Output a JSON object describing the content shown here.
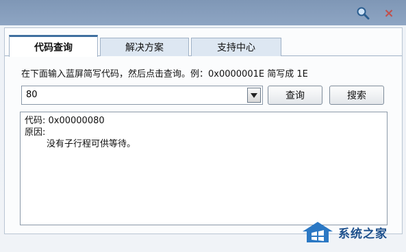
{
  "title_bar": {
    "search_icon": "magnifier-icon",
    "close_icon": "close-x-icon",
    "close_glyph": "×"
  },
  "tabs": [
    {
      "label": "代码查询",
      "active": true
    },
    {
      "label": "解决方案",
      "active": false
    },
    {
      "label": "支持中心",
      "active": false
    }
  ],
  "instruction": "在下面输入蓝屏简写代码，然后点击查询。例：0x0000001E 简写成 1E",
  "search": {
    "value": "80"
  },
  "buttons": {
    "query": "查询",
    "search": "搜索"
  },
  "result": {
    "code_line": "代码: 0x00000080",
    "reason_label": "原因:",
    "reason_text": "没有子行程可供等待。"
  },
  "watermark": {
    "text": "系统之家",
    "colors": {
      "primary": "#1c4f8c"
    }
  },
  "colors": {
    "title_bar": "#8ea5c3",
    "tab_active_border": "#3f6f9f",
    "close": "#c0504d"
  }
}
